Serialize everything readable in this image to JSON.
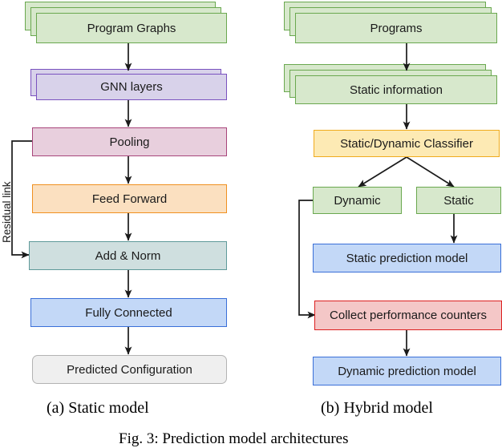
{
  "figure": {
    "caption_a": "(a) Static model",
    "caption_b": "(b) Hybrid model",
    "figure_caption": "Fig. 3: Prediction model architectures",
    "residual_label": "Residual link"
  },
  "colors": {
    "green_fill": "#d7e8cc",
    "green_stroke": "#6aa84f",
    "purple_fill": "#d8d2ea",
    "purple_stroke": "#7a52bf",
    "pink_fill": "#e8cfdd",
    "pink_stroke": "#a8457a",
    "orange_fill": "#fbe0c0",
    "orange_stroke": "#f09020",
    "teal_fill": "#cfdfdf",
    "teal_stroke": "#5f9a9a",
    "blue_fill": "#c3d8f7",
    "blue_stroke": "#3a6fd8",
    "grey_fill": "#efefef",
    "grey_stroke": "#b3b3b3",
    "yellow_fill": "#fdeab4",
    "yellow_stroke": "#f0ab1e",
    "red_fill": "#f4c7c7",
    "red_stroke": "#dc2020",
    "arrow": "#1a1a1a"
  },
  "static_model": {
    "nodes": [
      {
        "id": "program-graphs",
        "label": "Program Graphs",
        "color": "green",
        "stacked": 3
      },
      {
        "id": "gnn-layers",
        "label": "GNN layers",
        "color": "purple",
        "stacked": 2
      },
      {
        "id": "pooling",
        "label": "Pooling",
        "color": "pink",
        "stacked": 1
      },
      {
        "id": "feed-forward",
        "label": "Feed Forward",
        "color": "orange",
        "stacked": 1
      },
      {
        "id": "add-norm",
        "label": "Add & Norm",
        "color": "teal",
        "stacked": 1
      },
      {
        "id": "fully-connected",
        "label": "Fully Connected",
        "color": "blue",
        "stacked": 1
      },
      {
        "id": "predicted-configuration",
        "label": "Predicted Configuration",
        "color": "grey",
        "stacked": 1
      }
    ],
    "edges": [
      {
        "from": "program-graphs",
        "to": "gnn-layers",
        "kind": "straight"
      },
      {
        "from": "gnn-layers",
        "to": "pooling",
        "kind": "straight"
      },
      {
        "from": "pooling",
        "to": "feed-forward",
        "kind": "straight"
      },
      {
        "from": "feed-forward",
        "to": "add-norm",
        "kind": "straight"
      },
      {
        "from": "add-norm",
        "to": "fully-connected",
        "kind": "straight"
      },
      {
        "from": "fully-connected",
        "to": "predicted-configuration",
        "kind": "straight"
      },
      {
        "from": "pooling",
        "to": "add-norm",
        "kind": "residual"
      }
    ]
  },
  "hybrid_model": {
    "nodes": [
      {
        "id": "programs",
        "label": "Programs",
        "color": "green",
        "stacked": 3
      },
      {
        "id": "static-information",
        "label": "Static information",
        "color": "green",
        "stacked": 3
      },
      {
        "id": "static-dynamic-classifier",
        "label": "Static/Dynamic Classifier",
        "color": "yellow",
        "stacked": 1
      },
      {
        "id": "dynamic",
        "label": "Dynamic",
        "color": "green",
        "stacked": 1
      },
      {
        "id": "static",
        "label": "Static",
        "color": "green",
        "stacked": 1
      },
      {
        "id": "static-prediction-model",
        "label": "Static prediction model",
        "color": "blue",
        "stacked": 1
      },
      {
        "id": "collect-performance-counters",
        "label": "Collect performance counters",
        "color": "red",
        "stacked": 1
      },
      {
        "id": "dynamic-prediction-model",
        "label": "Dynamic prediction model",
        "color": "blue",
        "stacked": 1
      }
    ],
    "edges": [
      {
        "from": "programs",
        "to": "static-information",
        "kind": "straight"
      },
      {
        "from": "static-information",
        "to": "static-dynamic-classifier",
        "kind": "straight"
      },
      {
        "from": "static-dynamic-classifier",
        "to": "dynamic",
        "kind": "diagonal"
      },
      {
        "from": "static-dynamic-classifier",
        "to": "static",
        "kind": "diagonal"
      },
      {
        "from": "static",
        "to": "static-prediction-model",
        "kind": "straight"
      },
      {
        "from": "dynamic",
        "to": "collect-performance-counters",
        "kind": "elbow"
      },
      {
        "from": "collect-performance-counters",
        "to": "dynamic-prediction-model",
        "kind": "straight"
      }
    ]
  }
}
